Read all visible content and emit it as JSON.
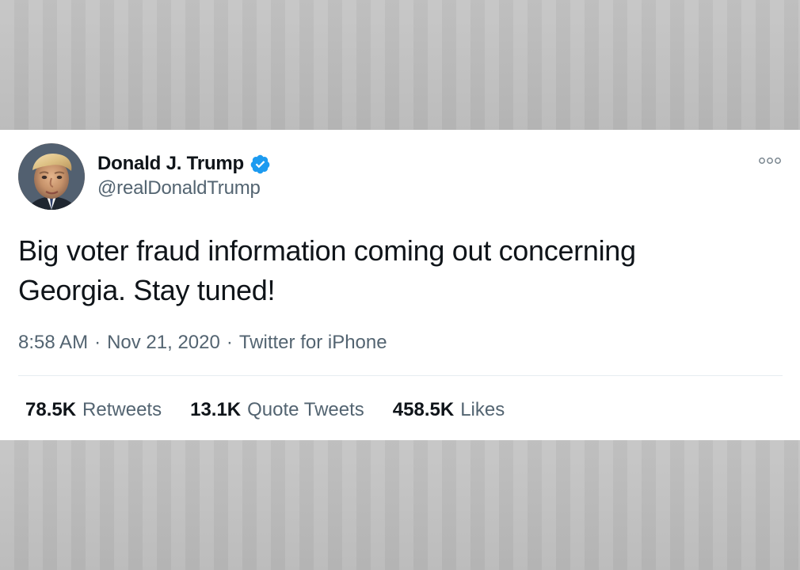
{
  "tweet": {
    "author": {
      "display_name": "Donald J. Trump",
      "handle": "@realDonaldTrump",
      "verified": true
    },
    "text_lines": [
      "Big voter fraud information coming out concerning",
      "Georgia. Stay tuned!"
    ],
    "meta": {
      "time": "8:58 AM",
      "separator": "·",
      "date": "Nov 21, 2020",
      "source": "Twitter for iPhone"
    },
    "stats": {
      "retweets": {
        "value": "78.5K",
        "label": "Retweets"
      },
      "quote_tweets": {
        "value": "13.1K",
        "label": "Quote Tweets"
      },
      "likes": {
        "value": "458.5K",
        "label": "Likes"
      }
    }
  },
  "icons": {
    "verified": "verified-badge-icon",
    "more": "more-options-icon"
  },
  "colors": {
    "verified_blue": "#1d9bf0",
    "text_primary": "#0f1419",
    "text_secondary": "#536471",
    "divider": "#e6ecf0",
    "card_background": "#ffffff",
    "page_background": "#c1c1c1"
  }
}
